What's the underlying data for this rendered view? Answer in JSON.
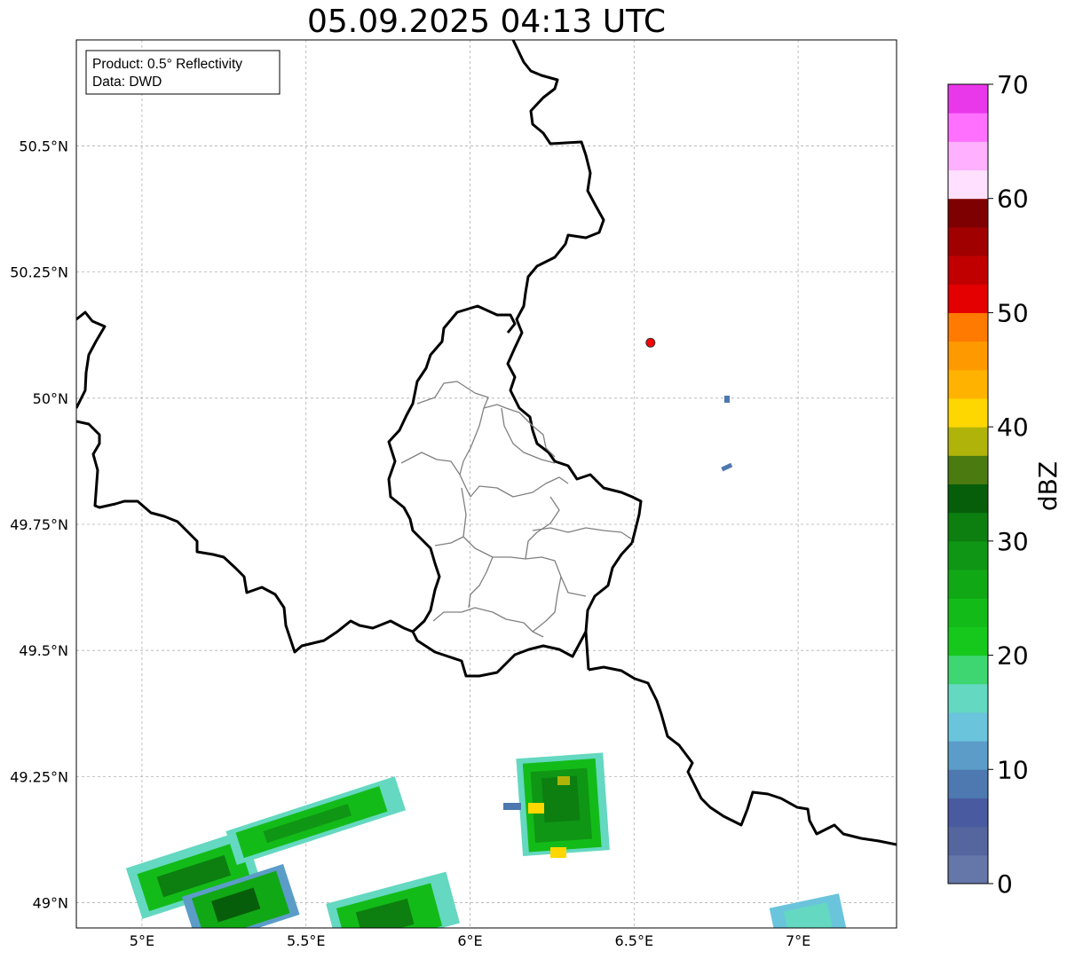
{
  "title": "05.09.2025 04:13 UTC",
  "info_box": {
    "line1": "Product: 0.5° Reflectivity",
    "line2": "Data: DWD"
  },
  "map": {
    "lon_range": [
      4.8,
      7.3
    ],
    "lat_range": [
      48.95,
      50.71
    ],
    "lon_ticks": [
      {
        "value": 5.0,
        "label": "5°E"
      },
      {
        "value": 5.5,
        "label": "5.5°E"
      },
      {
        "value": 6.0,
        "label": "6°E"
      },
      {
        "value": 6.5,
        "label": "6.5°E"
      },
      {
        "value": 7.0,
        "label": "7°E"
      }
    ],
    "lat_ticks": [
      {
        "value": 49.0,
        "label": "49°N"
      },
      {
        "value": 49.25,
        "label": "49.25°N"
      },
      {
        "value": 49.5,
        "label": "49.5°N"
      },
      {
        "value": 49.75,
        "label": "49.75°N"
      },
      {
        "value": 50.0,
        "label": "50°N"
      },
      {
        "value": 50.25,
        "label": "50.25°N"
      },
      {
        "value": 50.5,
        "label": "50.5°N"
      }
    ],
    "gridlines": true,
    "radar_site": {
      "lon": 6.55,
      "lat": 50.11,
      "color": "#ff0000"
    }
  },
  "colorbar": {
    "label": "dBZ",
    "min": 0,
    "max": 70,
    "tick_labels": [
      "0",
      "10",
      "20",
      "30",
      "40",
      "50",
      "60",
      "70"
    ],
    "colors": [
      "#6577a8",
      "#55659e",
      "#4a5aa0",
      "#4d78b0",
      "#5b9dc8",
      "#6ac4dc",
      "#64d8c0",
      "#3dd670",
      "#16c81c",
      "#13bb18",
      "#11a816",
      "#0f9614",
      "#0c7f10",
      "#075e0a",
      "#4a7a10",
      "#b0b40a",
      "#ffd700",
      "#ffb300",
      "#ff9900",
      "#ff7a00",
      "#e40000",
      "#c00000",
      "#a00000",
      "#7e0000",
      "#ffe0ff",
      "#ffb0ff",
      "#ff70ff",
      "#e938e9"
    ]
  }
}
